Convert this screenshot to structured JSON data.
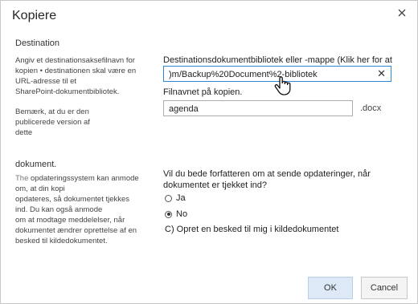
{
  "dialog": {
    "title": "Kopiere"
  },
  "destination": {
    "section_title": "Destination",
    "description": "Angiv et destinationsaksefilnavn for kopien • destinationen skal være en URL-adresse til et\nSharePoint-dokumentbibliotek.",
    "note": "Bemærk, at du er den publicerede version af\ndette",
    "library_label": "Destinationsdokumentbibliotek eller -mappe (Klik her for at teste):",
    "library_value": ")m/Backup%20Document%2-bibliotek",
    "filename_label": "Filnavnet på kopien.",
    "filename_value": "agenda",
    "filename_suffix": ".docx"
  },
  "update": {
    "section_title": "dokument.",
    "description_prefix": "The",
    "description": " opdateringssystem kan anmode om, at din kopi\nopdateres, så dokumentet tjekkes\nind. Du kan også anmode\nom at modtage meddelelser, når\ndokumentet ændrer oprettelse af en\nbesked til kildedokumentet.",
    "question": "Vil du bede forfatteren om at sende opdateringer, når dokumentet er tjekket ind?",
    "options": [
      {
        "label": "Ja",
        "checked": false
      },
      {
        "label": "No",
        "checked": true
      }
    ],
    "alert_option": "C) Opret en besked til mig i kildedokumentet"
  },
  "buttons": {
    "ok": "OK",
    "cancel": "Cancel"
  },
  "icons": {
    "close": "close-icon",
    "clear": "clear-icon",
    "cursor": "hand-cursor-icon"
  }
}
